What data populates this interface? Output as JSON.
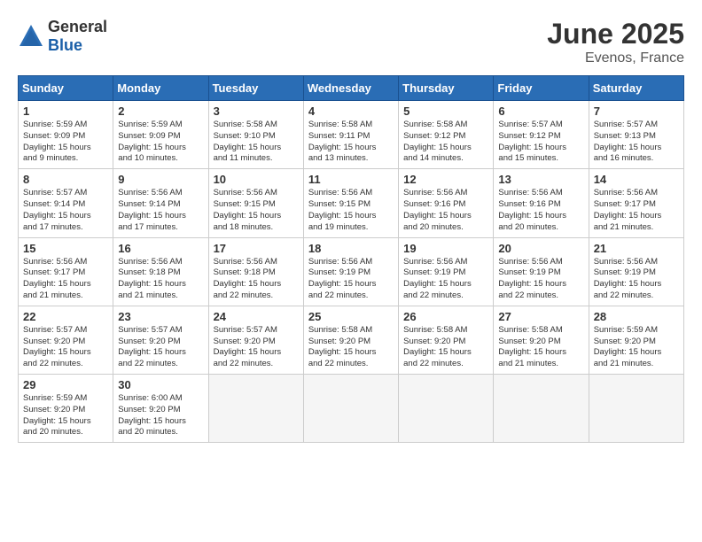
{
  "logo": {
    "general": "General",
    "blue": "Blue"
  },
  "title": "June 2025",
  "location": "Evenos, France",
  "days_header": [
    "Sunday",
    "Monday",
    "Tuesday",
    "Wednesday",
    "Thursday",
    "Friday",
    "Saturday"
  ],
  "weeks": [
    [
      {
        "day": "1",
        "info": "Sunrise: 5:59 AM\nSunset: 9:09 PM\nDaylight: 15 hours\nand 9 minutes."
      },
      {
        "day": "2",
        "info": "Sunrise: 5:59 AM\nSunset: 9:09 PM\nDaylight: 15 hours\nand 10 minutes."
      },
      {
        "day": "3",
        "info": "Sunrise: 5:58 AM\nSunset: 9:10 PM\nDaylight: 15 hours\nand 11 minutes."
      },
      {
        "day": "4",
        "info": "Sunrise: 5:58 AM\nSunset: 9:11 PM\nDaylight: 15 hours\nand 13 minutes."
      },
      {
        "day": "5",
        "info": "Sunrise: 5:58 AM\nSunset: 9:12 PM\nDaylight: 15 hours\nand 14 minutes."
      },
      {
        "day": "6",
        "info": "Sunrise: 5:57 AM\nSunset: 9:12 PM\nDaylight: 15 hours\nand 15 minutes."
      },
      {
        "day": "7",
        "info": "Sunrise: 5:57 AM\nSunset: 9:13 PM\nDaylight: 15 hours\nand 16 minutes."
      }
    ],
    [
      {
        "day": "8",
        "info": "Sunrise: 5:57 AM\nSunset: 9:14 PM\nDaylight: 15 hours\nand 17 minutes."
      },
      {
        "day": "9",
        "info": "Sunrise: 5:56 AM\nSunset: 9:14 PM\nDaylight: 15 hours\nand 17 minutes."
      },
      {
        "day": "10",
        "info": "Sunrise: 5:56 AM\nSunset: 9:15 PM\nDaylight: 15 hours\nand 18 minutes."
      },
      {
        "day": "11",
        "info": "Sunrise: 5:56 AM\nSunset: 9:15 PM\nDaylight: 15 hours\nand 19 minutes."
      },
      {
        "day": "12",
        "info": "Sunrise: 5:56 AM\nSunset: 9:16 PM\nDaylight: 15 hours\nand 20 minutes."
      },
      {
        "day": "13",
        "info": "Sunrise: 5:56 AM\nSunset: 9:16 PM\nDaylight: 15 hours\nand 20 minutes."
      },
      {
        "day": "14",
        "info": "Sunrise: 5:56 AM\nSunset: 9:17 PM\nDaylight: 15 hours\nand 21 minutes."
      }
    ],
    [
      {
        "day": "15",
        "info": "Sunrise: 5:56 AM\nSunset: 9:17 PM\nDaylight: 15 hours\nand 21 minutes."
      },
      {
        "day": "16",
        "info": "Sunrise: 5:56 AM\nSunset: 9:18 PM\nDaylight: 15 hours\nand 21 minutes."
      },
      {
        "day": "17",
        "info": "Sunrise: 5:56 AM\nSunset: 9:18 PM\nDaylight: 15 hours\nand 22 minutes."
      },
      {
        "day": "18",
        "info": "Sunrise: 5:56 AM\nSunset: 9:19 PM\nDaylight: 15 hours\nand 22 minutes."
      },
      {
        "day": "19",
        "info": "Sunrise: 5:56 AM\nSunset: 9:19 PM\nDaylight: 15 hours\nand 22 minutes."
      },
      {
        "day": "20",
        "info": "Sunrise: 5:56 AM\nSunset: 9:19 PM\nDaylight: 15 hours\nand 22 minutes."
      },
      {
        "day": "21",
        "info": "Sunrise: 5:56 AM\nSunset: 9:19 PM\nDaylight: 15 hours\nand 22 minutes."
      }
    ],
    [
      {
        "day": "22",
        "info": "Sunrise: 5:57 AM\nSunset: 9:20 PM\nDaylight: 15 hours\nand 22 minutes."
      },
      {
        "day": "23",
        "info": "Sunrise: 5:57 AM\nSunset: 9:20 PM\nDaylight: 15 hours\nand 22 minutes."
      },
      {
        "day": "24",
        "info": "Sunrise: 5:57 AM\nSunset: 9:20 PM\nDaylight: 15 hours\nand 22 minutes."
      },
      {
        "day": "25",
        "info": "Sunrise: 5:58 AM\nSunset: 9:20 PM\nDaylight: 15 hours\nand 22 minutes."
      },
      {
        "day": "26",
        "info": "Sunrise: 5:58 AM\nSunset: 9:20 PM\nDaylight: 15 hours\nand 22 minutes."
      },
      {
        "day": "27",
        "info": "Sunrise: 5:58 AM\nSunset: 9:20 PM\nDaylight: 15 hours\nand 21 minutes."
      },
      {
        "day": "28",
        "info": "Sunrise: 5:59 AM\nSunset: 9:20 PM\nDaylight: 15 hours\nand 21 minutes."
      }
    ],
    [
      {
        "day": "29",
        "info": "Sunrise: 5:59 AM\nSunset: 9:20 PM\nDaylight: 15 hours\nand 20 minutes."
      },
      {
        "day": "30",
        "info": "Sunrise: 6:00 AM\nSunset: 9:20 PM\nDaylight: 15 hours\nand 20 minutes."
      },
      {
        "day": "",
        "info": ""
      },
      {
        "day": "",
        "info": ""
      },
      {
        "day": "",
        "info": ""
      },
      {
        "day": "",
        "info": ""
      },
      {
        "day": "",
        "info": ""
      }
    ]
  ]
}
